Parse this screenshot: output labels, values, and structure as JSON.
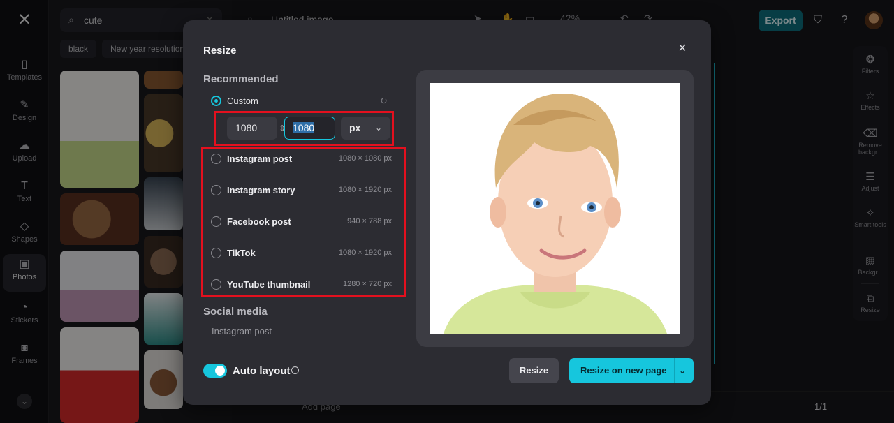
{
  "app": {
    "search_query": "cute",
    "chips": [
      "black",
      "New year resolution"
    ],
    "rail": [
      {
        "label": "Templates",
        "icon": "templates-icon"
      },
      {
        "label": "Design",
        "icon": "design-icon"
      },
      {
        "label": "Upload",
        "icon": "upload-icon"
      },
      {
        "label": "Text",
        "icon": "text-icon"
      },
      {
        "label": "Shapes",
        "icon": "shapes-icon"
      },
      {
        "label": "Photos",
        "icon": "photos-icon"
      },
      {
        "label": "Stickers",
        "icon": "stickers-icon"
      },
      {
        "label": "Frames",
        "icon": "frames-icon"
      }
    ],
    "doc_title": "Untitled image",
    "zoom": "42%",
    "export_label": "Export",
    "right_tools": [
      {
        "label": "Filters"
      },
      {
        "label": "Effects"
      },
      {
        "label": "Remove backgr..."
      },
      {
        "label": "Adjust"
      },
      {
        "label": "Smart tools"
      },
      {
        "label": "Backgr..."
      },
      {
        "label": "Resize"
      }
    ],
    "add_page_label": "Add page",
    "page_count": "1/1"
  },
  "modal": {
    "title": "Resize",
    "recommended_label": "Recommended",
    "custom_label": "Custom",
    "width_value": "1080",
    "height_value": "1080",
    "unit": "px",
    "presets": [
      {
        "label": "Instagram post",
        "dims": "1080 × 1080 px"
      },
      {
        "label": "Instagram story",
        "dims": "1080 × 1920 px"
      },
      {
        "label": "Facebook post",
        "dims": "940 × 788 px"
      },
      {
        "label": "TikTok",
        "dims": "1080 × 1920 px"
      },
      {
        "label": "YouTube thumbnail",
        "dims": "1280 × 720 px"
      }
    ],
    "social_media_label": "Social media",
    "social_first_item": "Instagram post",
    "auto_layout_label": "Auto layout",
    "auto_layout_on": true,
    "resize_button": "Resize",
    "resize_new_page_button": "Resize on new page",
    "accent_color": "#16c6dd",
    "highlight_color": "#e3101e"
  }
}
